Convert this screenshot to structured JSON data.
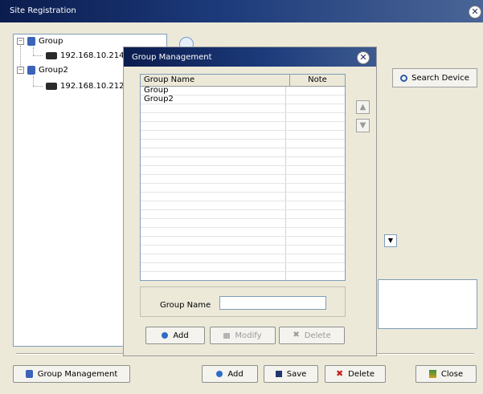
{
  "window": {
    "title": "Site Registration",
    "close_icon": "close-icon"
  },
  "tree": {
    "nodes": [
      {
        "label": "Group",
        "icon": "group-icon"
      },
      {
        "label": "192.168.10.214",
        "icon": "device-icon"
      },
      {
        "label": "Group2",
        "icon": "group-icon"
      },
      {
        "label": "192.168.10.212",
        "icon": "device-icon"
      }
    ]
  },
  "buttons": {
    "search_device": "Search Device",
    "group_management": "Group Management",
    "add": "Add",
    "save": "Save",
    "delete": "Delete",
    "close": "Close"
  },
  "dialog": {
    "title": "Group Management",
    "columns": [
      "Group Name",
      "Note"
    ],
    "rows": [
      {
        "name": "Group",
        "note": ""
      },
      {
        "name": "Group2",
        "note": ""
      }
    ],
    "name_label": "Group Name",
    "name_value": "",
    "buttons": {
      "add": "Add",
      "modify": "Modify",
      "delete": "Delete"
    }
  },
  "colors": {
    "titlebar": "#0b1c4e",
    "window_bg": "#ece9d8",
    "delete_icon": "#c62020"
  }
}
